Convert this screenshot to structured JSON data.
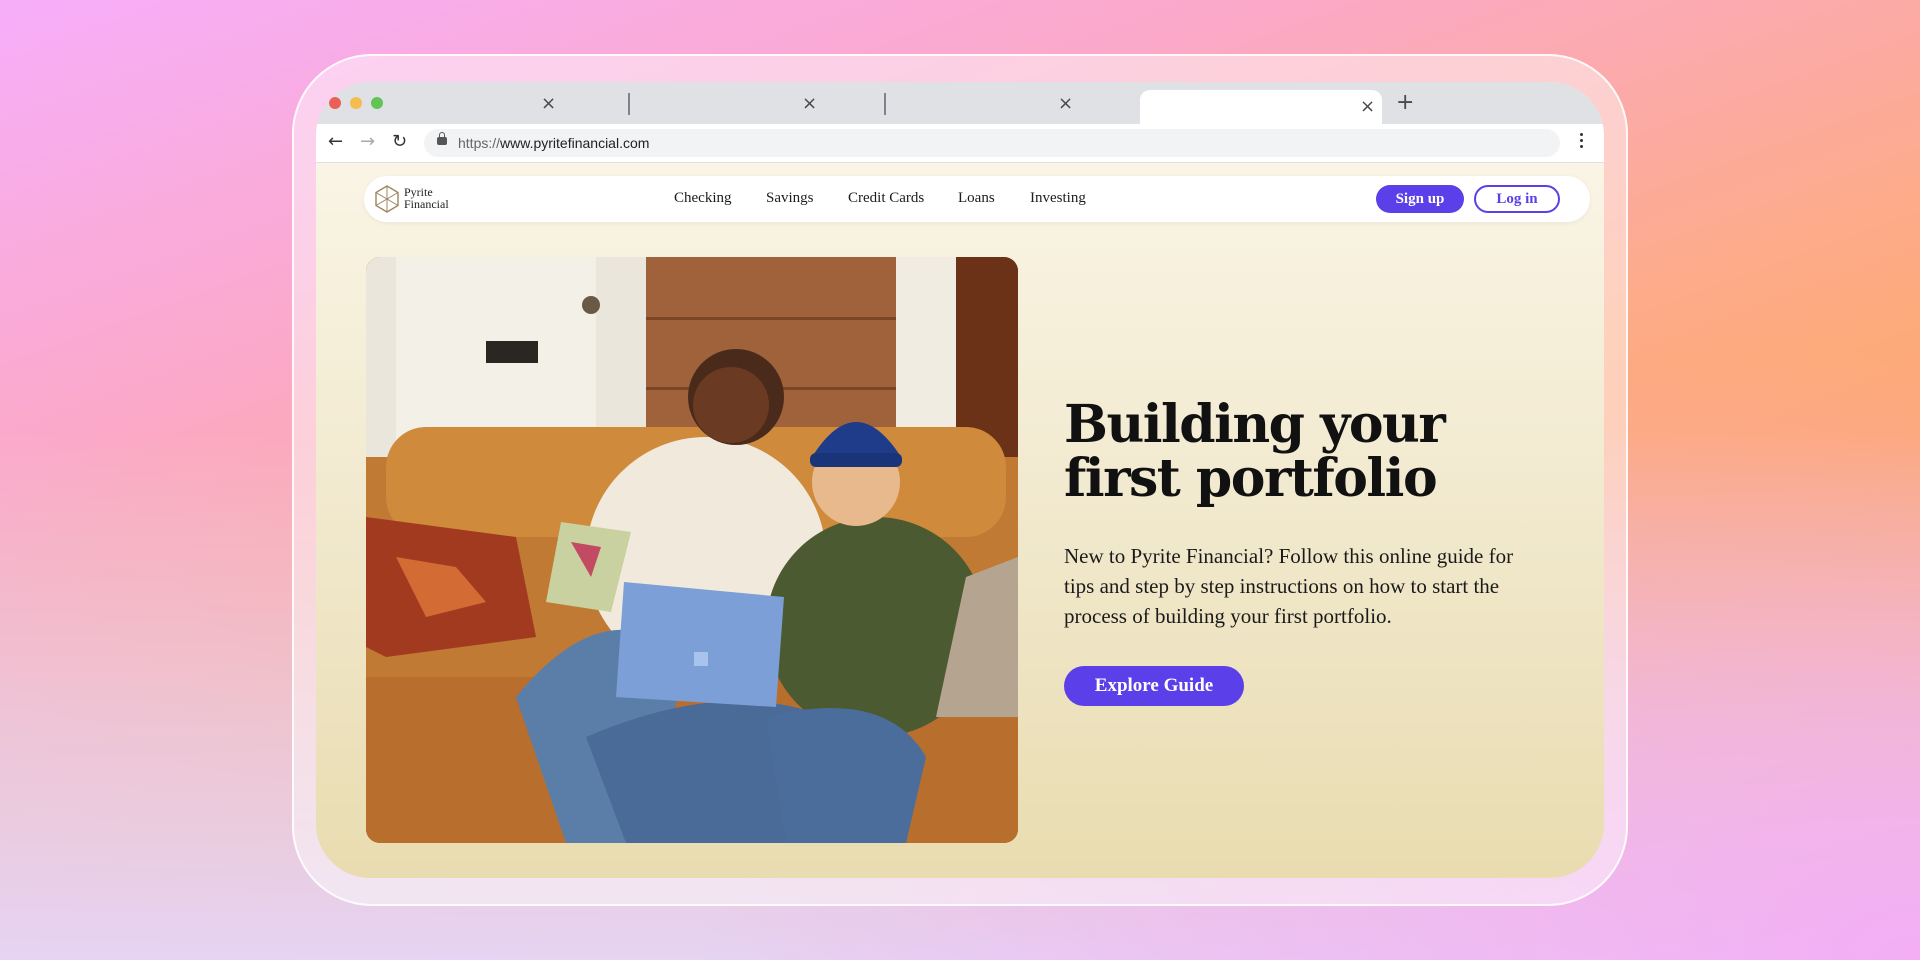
{
  "browser": {
    "tabs": [
      {
        "title": "",
        "active": false
      },
      {
        "title": "",
        "active": false
      },
      {
        "title": "",
        "active": false
      },
      {
        "title": "",
        "active": true
      }
    ],
    "close_glyph": "×",
    "newtab_glyph": "+",
    "back_glyph": "←",
    "forward_glyph": "→",
    "reload_glyph": "↻",
    "url_scheme": "https://",
    "url_host": "www.pyritefinancial.com",
    "traffic_lights": [
      "#ed5f56",
      "#f5bd4f",
      "#61c454"
    ]
  },
  "site": {
    "logo": {
      "line1": "Pyrite",
      "line2": "Financial"
    },
    "nav": [
      "Checking",
      "Savings",
      "Credit Cards",
      "Loans",
      "Investing"
    ],
    "signup_label": "Sign up",
    "login_label": "Log in",
    "accent_color": "#5b3fe8"
  },
  "hero": {
    "headline_line1": "Building your",
    "headline_line2": "first portfolio",
    "body": "New to Pyrite Financial? Follow this online guide for tips and step by step instructions on how to start the process of building your first portfolio.",
    "cta_label": "Explore Guide",
    "image": "two-friends-laughing-on-couch-with-laptop"
  }
}
